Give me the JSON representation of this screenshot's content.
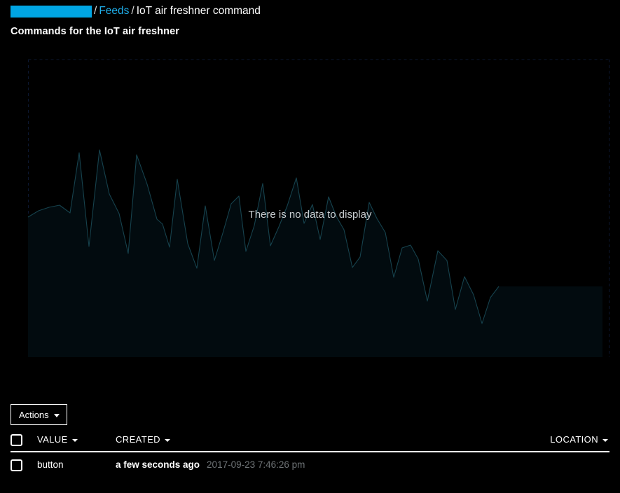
{
  "breadcrumb": {
    "redacted_label": "",
    "separator": "/",
    "feeds_label": "Feeds",
    "current_label": "IoT air freshner command",
    "redacted_color": "#00a5e3",
    "link_color": "#1fb0ec"
  },
  "page": {
    "subtitle": "Commands for the IoT air freshner"
  },
  "chart": {
    "empty_message": "There is no data to display",
    "fill_color": "#020b0f",
    "stroke_color": "#16424d",
    "grid_color": "#0c1730"
  },
  "toolbar": {
    "actions_label": "Actions"
  },
  "table": {
    "columns": [
      {
        "key": "value",
        "label": "VALUE",
        "sortable": true
      },
      {
        "key": "created",
        "label": "CREATED",
        "sortable": true
      },
      {
        "key": "location",
        "label": "LOCATION",
        "sortable": true
      }
    ],
    "rows": [
      {
        "value": "button",
        "created_relative": "a few seconds ago",
        "created_absolute": "2017-09-23 7:46:26 pm",
        "location": ""
      }
    ]
  },
  "chart_data": {
    "type": "area",
    "title": "",
    "xlabel": "",
    "ylabel": "",
    "grid": true,
    "legend": "none",
    "empty_state": "There is no data to display",
    "x": [
      0,
      1,
      2,
      3,
      4,
      5,
      6,
      7,
      8,
      9,
      10,
      11,
      12,
      13,
      14,
      15,
      16,
      17,
      18,
      19,
      20,
      21,
      22,
      23,
      24,
      25,
      26,
      27,
      28,
      29,
      30,
      31,
      32,
      33,
      34,
      35,
      36,
      37,
      38,
      39,
      40,
      41,
      42,
      43,
      44,
      45,
      46,
      47,
      48,
      49,
      50,
      51,
      52,
      53,
      54
    ],
    "values": [
      0.64,
      0.7,
      0.74,
      0.76,
      0.3,
      0.88,
      0.38,
      0.98,
      0.72,
      0.68,
      0.22,
      0.86,
      0.44,
      0.16,
      0.52,
      0.48,
      0.8,
      0.3,
      0.1,
      0.62,
      0.26,
      0.52,
      0.74,
      0.76,
      0.36,
      0.3,
      0.5,
      0.46,
      0.4,
      0.34,
      0.62,
      0.52,
      0.58,
      0.42,
      0.66,
      0.56,
      0.48,
      0.18,
      0.22,
      0.56,
      0.5,
      0.44,
      0.12,
      0.32,
      0.3,
      0.24,
      0.04,
      0.4,
      0.28,
      0.08,
      0.26,
      0.16,
      0.02,
      0.14,
      0.18
    ],
    "ylim": [
      0,
      1
    ],
    "series": [
      {
        "name": "IoT air freshner command",
        "values": [
          0.64,
          0.7,
          0.74,
          0.76,
          0.3,
          0.88,
          0.38,
          0.98,
          0.72,
          0.68,
          0.22,
          0.86,
          0.44,
          0.16,
          0.52,
          0.48,
          0.8,
          0.3,
          0.1,
          0.62,
          0.26,
          0.52,
          0.74,
          0.76,
          0.36,
          0.3,
          0.5,
          0.46,
          0.4,
          0.34,
          0.62,
          0.52,
          0.58,
          0.42,
          0.66,
          0.56,
          0.48,
          0.18,
          0.22,
          0.56,
          0.5,
          0.44,
          0.12,
          0.32,
          0.3,
          0.24,
          0.04,
          0.4,
          0.28,
          0.08,
          0.26,
          0.16,
          0.02,
          0.14,
          0.18
        ]
      }
    ]
  }
}
